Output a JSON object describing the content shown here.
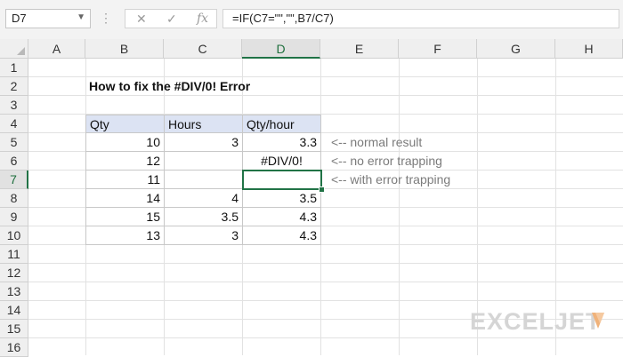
{
  "formula_bar": {
    "name_box": "D7",
    "dots": "⋮",
    "cancel_icon": "✕",
    "enter_icon": "✓",
    "fx_label": "fx",
    "formula": "=IF(C7=\"\",\"\",B7/C7)"
  },
  "columns": [
    "A",
    "B",
    "C",
    "D",
    "E",
    "F",
    "G",
    "H"
  ],
  "rows": [
    "1",
    "2",
    "3",
    "4",
    "5",
    "6",
    "7",
    "8",
    "9",
    "10",
    "11",
    "12",
    "13",
    "14",
    "15",
    "16"
  ],
  "sheet": {
    "title": "How to fix the #DIV/0! Error",
    "headers": [
      "Qty",
      "Hours",
      "Qty/hour"
    ],
    "data": [
      [
        "10",
        "3",
        "3.3"
      ],
      [
        "12",
        "",
        "#DIV/0!"
      ],
      [
        "11",
        "",
        ""
      ],
      [
        "14",
        "4",
        "3.5"
      ],
      [
        "15",
        "3.5",
        "4.3"
      ],
      [
        "13",
        "3",
        "4.3"
      ]
    ],
    "notes": [
      "<-- normal result",
      "<-- no error trapping",
      "<-- with error trapping"
    ]
  },
  "selection": {
    "cell": "D7",
    "column": "D",
    "row": "7"
  },
  "logo": {
    "text": "EXCELJET"
  },
  "colors": {
    "accent": "#217346",
    "header_fill": "#dce3f3",
    "note_text": "#7b7b7b",
    "logo": "#d5d5d5",
    "logo_mark": "#f0b27a"
  }
}
